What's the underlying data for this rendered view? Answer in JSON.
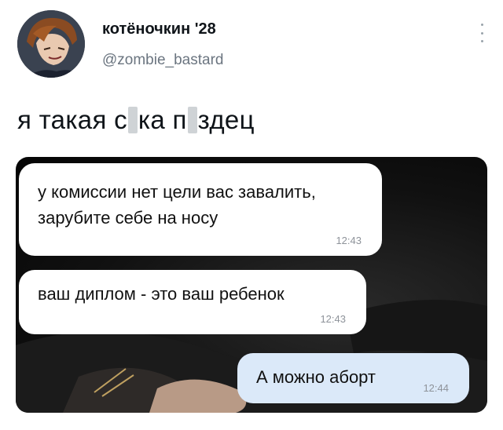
{
  "header": {
    "display_name": "котёночкин '28",
    "username": "@zombie_bastard",
    "menu_icon": "vertical-dots-icon"
  },
  "tweet": {
    "part1": "я такая с",
    "part2": "ка п",
    "part3": "здец"
  },
  "media": {
    "messages": [
      {
        "text": "у комиссии нет цели вас завалить, зарубите себе на носу",
        "time": "12:43",
        "direction": "incoming"
      },
      {
        "text": "ваш диплом - это ваш ребенок",
        "time": "12:43",
        "direction": "incoming"
      },
      {
        "text": "А можно аборт",
        "time": "12:44",
        "direction": "outgoing"
      }
    ]
  },
  "colors": {
    "incoming_bubble": "#ffffff",
    "outgoing_bubble": "#dbe9f9",
    "muted_text": "#6b7580"
  }
}
